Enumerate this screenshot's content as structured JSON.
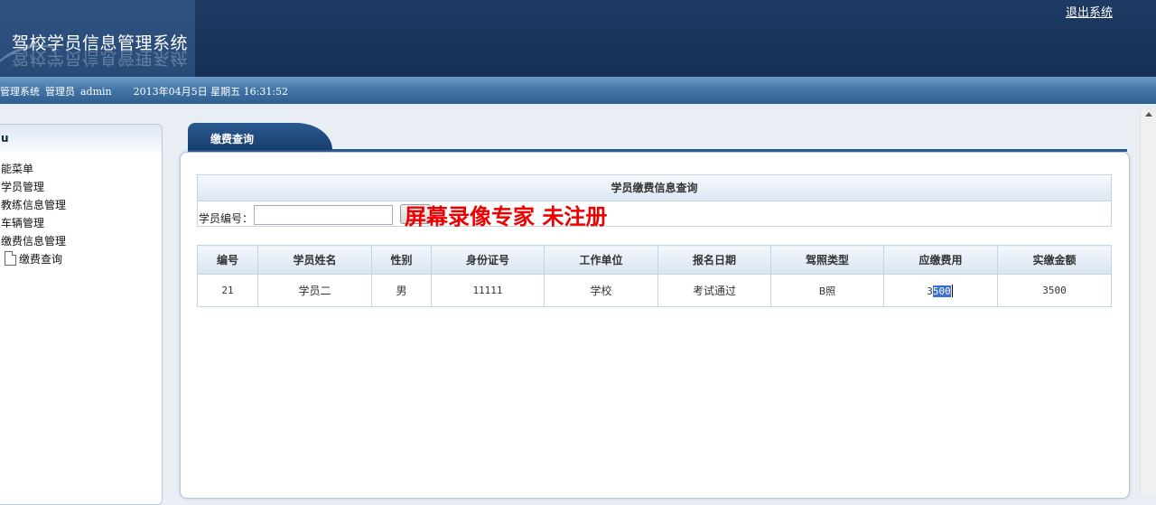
{
  "header": {
    "app_title": "驾校学员信息管理系统",
    "logout_link": "退出系统"
  },
  "status_bar": {
    "system": "管理系统",
    "role": "管理员",
    "user": "admin",
    "datetime": "2013年04月5日 星期五 16:31:52"
  },
  "sidebar": {
    "title": "u",
    "items": [
      {
        "label": "能菜单"
      },
      {
        "label": "学员管理"
      },
      {
        "label": "教练信息管理"
      },
      {
        "label": "车辆管理"
      },
      {
        "label": "缴费信息管理"
      },
      {
        "label": "缴费查询",
        "icon": "document-icon"
      }
    ]
  },
  "main": {
    "tab_label": "缴费查询",
    "search": {
      "title": "学员缴费信息查询",
      "label": "学员编号：",
      "input_value": "",
      "button_label": ""
    },
    "watermark": "屏幕录像专家 未注册",
    "table": {
      "headers": [
        "编号",
        "学员姓名",
        "性别",
        "身份证号",
        "工作单位",
        "报名日期",
        "驾照类型",
        "应缴费用",
        "实缴金额"
      ],
      "rows": [
        {
          "id": "21",
          "name": "学员二",
          "gender": "男",
          "id_card": "11111",
          "work_unit": "学校",
          "signup_date": "考试通过",
          "license_type": "B照",
          "due_prefix": "3",
          "due_selected": "500",
          "paid": "3500"
        }
      ]
    }
  },
  "colors": {
    "header_bg": "#1a3459",
    "status_bar": "#4477a8",
    "tab_bg": "#1f4a7c",
    "selection": "#3b6fd6",
    "watermark": "#ee0000"
  }
}
